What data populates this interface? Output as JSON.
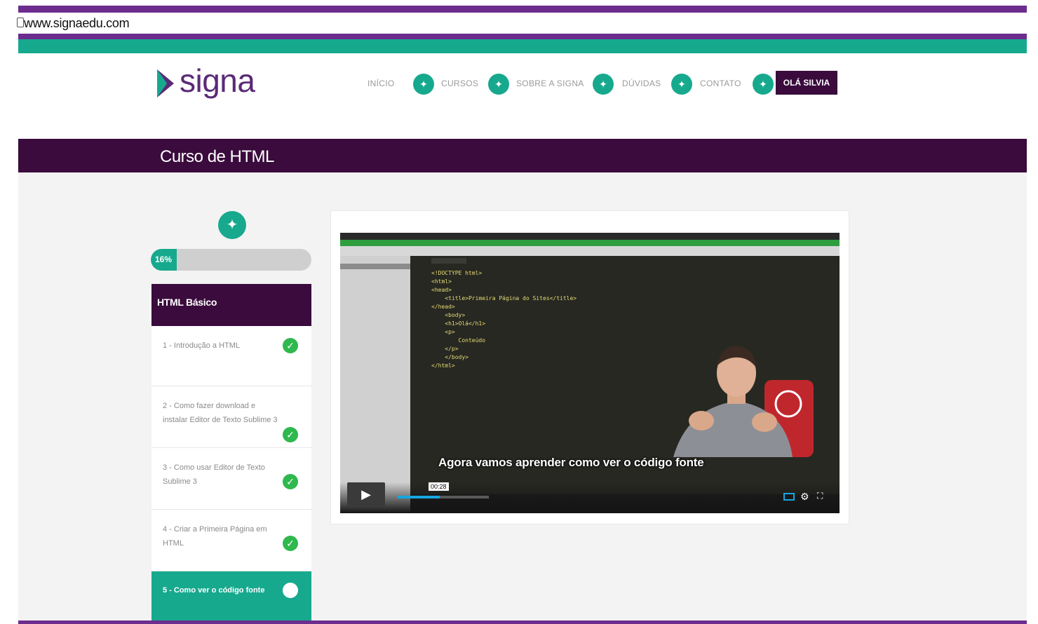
{
  "browser": {
    "url": "www.signaedu.com"
  },
  "header": {
    "logo_text": "signa",
    "nav": [
      {
        "label": "INÍCIO"
      },
      {
        "label": "CURSOS"
      },
      {
        "label": "SOBRE A SIGNA"
      },
      {
        "label": "DÚVIDAS"
      },
      {
        "label": "CONTATO"
      }
    ],
    "user_label": "OLÁ SILVIA"
  },
  "course": {
    "title": "Curso de HTML"
  },
  "sidebar": {
    "progress_text": "16%",
    "progress_value": 16,
    "module_title": "HTML Básico",
    "lessons": [
      {
        "label": "1 - Introdução a HTML",
        "completed": true
      },
      {
        "label": "2 - Como fazer download e instalar Editor de Texto Sublime 3",
        "completed": true
      },
      {
        "label": "3 - Como usar Editor de Texto Sublime 3",
        "completed": true
      },
      {
        "label": "4 - Criar a Primeira Página em HTML",
        "completed": true
      },
      {
        "label": "5 - Como ver o código fonte",
        "completed": false,
        "active": true
      }
    ]
  },
  "video": {
    "subtitle": "Agora vamos aprender como ver o código fonte",
    "time": "00:28",
    "code_lines": [
      "<!DOCTYPE html>",
      "<html>",
      "<head>",
      "    <title>Primeira Página do Sites</title>",
      "</head>",
      "    <body>",
      "    <h1>Olá</h1>",
      "    <p>",
      "        Conteúdo",
      "    </p>",
      "    </body>",
      "</html>"
    ]
  },
  "colors": {
    "teal": "#17a98e",
    "purple_dark": "#3a0b3c",
    "brand_purple": "#5a2a77",
    "check_green": "#2fb84d"
  }
}
